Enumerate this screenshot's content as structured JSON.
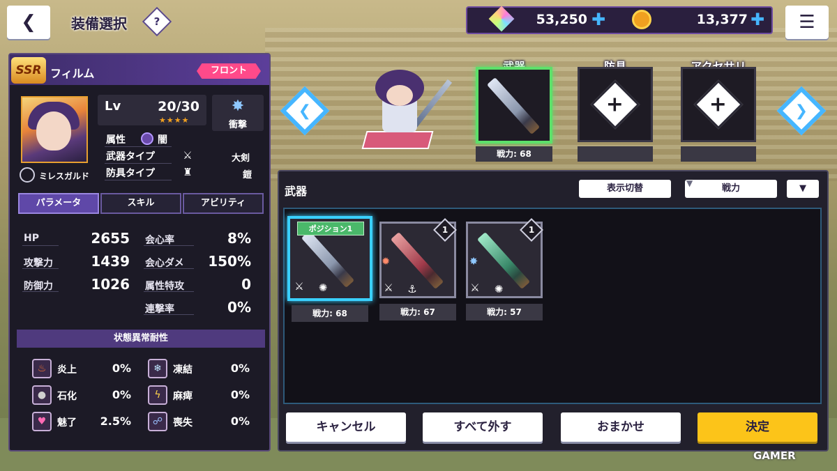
{
  "header": {
    "title": "装備選択",
    "help_label": "?",
    "back_icon": "back-arrow-icon",
    "menu_icon": "sort-menu-icon"
  },
  "currency": {
    "gems": "53,250",
    "coins": "13,377",
    "plus": "✚"
  },
  "character": {
    "rarity": "SSR",
    "name": "フィルム",
    "position_badge": "フロント",
    "level_label": "Lv",
    "level_value": "20/30",
    "stars": "★★★★",
    "type_label": "衝撃",
    "attribute_label": "属性",
    "attribute_value": "闇",
    "weapon_type_label": "武器タイプ",
    "weapon_type_value": "大剣",
    "armor_type_label": "防具タイプ",
    "armor_type_value": "鎧",
    "guild": "ミレスガルド"
  },
  "tabs": [
    {
      "label": "パラメータ"
    },
    {
      "label": "スキル"
    },
    {
      "label": "アビリティ"
    }
  ],
  "stats": [
    {
      "label": "HP",
      "value": "2655"
    },
    {
      "label": "攻撃力",
      "value": "1439"
    },
    {
      "label": "防御力",
      "value": "1026"
    },
    {
      "label": "会心率",
      "value": "8%"
    },
    {
      "label": "会心ダメ",
      "value": "150%"
    },
    {
      "label": "属性特攻",
      "value": "0"
    },
    {
      "label": "連撃率",
      "value": "0%"
    }
  ],
  "resist": {
    "title": "状態異常耐性",
    "items": [
      {
        "label": "炎上",
        "value": "0%",
        "icon": "fire-icon"
      },
      {
        "label": "凍結",
        "value": "0%",
        "icon": "snowflake-icon"
      },
      {
        "label": "石化",
        "value": "0%",
        "icon": "petrify-icon"
      },
      {
        "label": "麻痺",
        "value": "0%",
        "icon": "paralysis-icon"
      },
      {
        "label": "魅了",
        "value": "2.5%",
        "icon": "heart-icon"
      },
      {
        "label": "喪失",
        "value": "0%",
        "icon": "loss-icon"
      }
    ]
  },
  "slots": [
    {
      "label": "武器",
      "power": "戦力: 68"
    },
    {
      "label": "防具",
      "power": ""
    },
    {
      "label": "アクセサリ",
      "power": ""
    }
  ],
  "weapon_panel": {
    "title": "武器",
    "toggle_label": "表示切替",
    "sort_label": "戦力",
    "dropdown": "▼",
    "position_tag": "ポジション1",
    "cards": [
      {
        "power": "戦力: 68",
        "count": ""
      },
      {
        "power": "戦力: 67",
        "count": "1"
      },
      {
        "power": "戦力: 57",
        "count": "1"
      }
    ]
  },
  "actions": {
    "cancel": "キャンセル",
    "remove_all": "すべて外す",
    "auto": "おまかせ",
    "confirm": "決定"
  },
  "watermark": "GAMER",
  "colors": {
    "accent_blue": "#46b6ff",
    "selected_green": "#5de06a",
    "confirm_yellow": "#fcc419",
    "badge_pink": "#ff4a8a",
    "panel_purple": "#5f48a8"
  }
}
